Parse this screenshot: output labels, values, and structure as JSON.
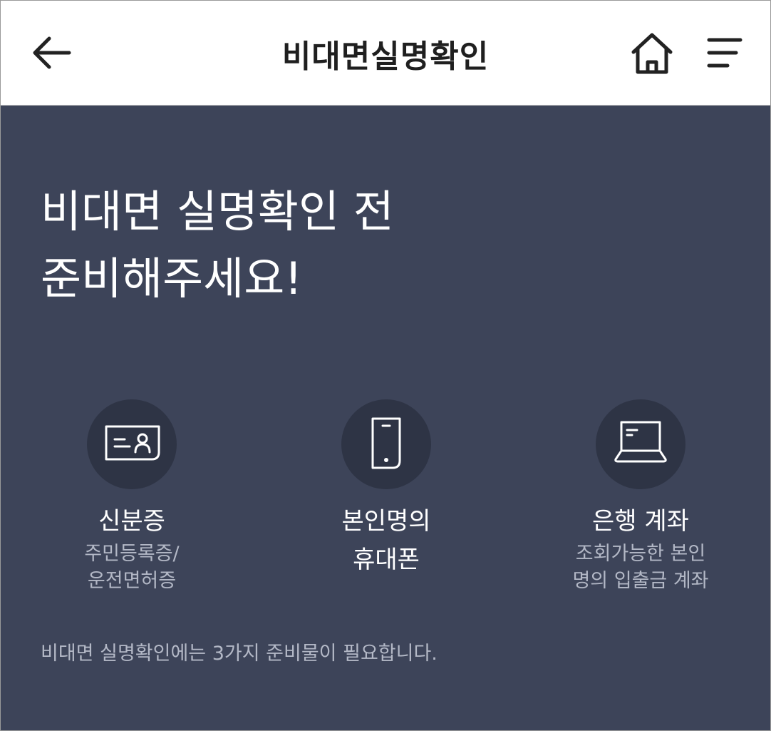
{
  "header": {
    "title": "비대면실명확인",
    "icons": {
      "back": "arrow-left-icon",
      "home": "home-icon",
      "menu": "hamburger-menu-icon"
    }
  },
  "main": {
    "headline": [
      "비대면 실명확인 전",
      "준비해주세요!"
    ],
    "items": [
      {
        "icon": "id-card-icon",
        "label": [
          "신분증"
        ],
        "sub": [
          "주민등록증/",
          "운전면허증"
        ]
      },
      {
        "icon": "smartphone-icon",
        "label": [
          "본인명의",
          "휴대폰"
        ],
        "sub": []
      },
      {
        "icon": "laptop-icon",
        "label": [
          "은행 계좌"
        ],
        "sub": [
          "조회가능한 본인",
          "명의 입출금 계좌"
        ]
      }
    ],
    "footer_note": "비대면 실명확인에는 3가지 준비물이 필요합니다."
  },
  "colors": {
    "background": "#3d4459",
    "icon_circle": "#2e3445",
    "header_bg": "#ffffff",
    "secondary_text": "#b3b8c6"
  }
}
